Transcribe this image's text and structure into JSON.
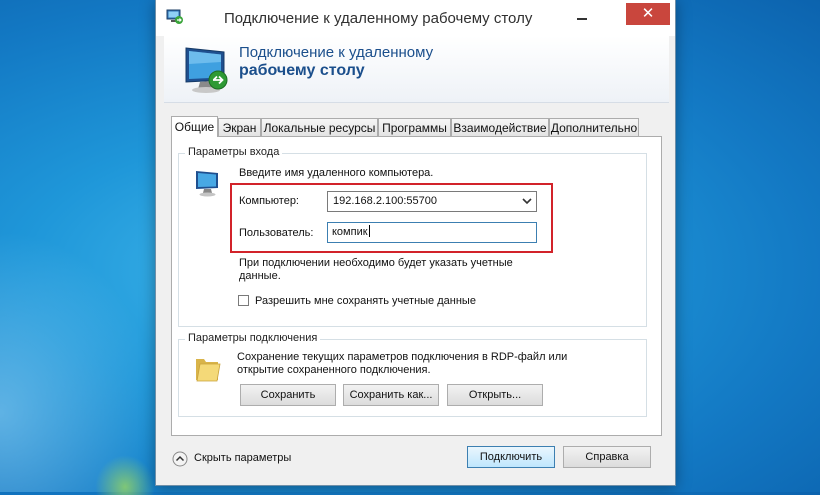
{
  "window": {
    "title": "Подключение к удаленному рабочему столу",
    "close_glyph": "✕",
    "minimize_icon": "minimize-icon",
    "app_icon": "remote-desktop-icon"
  },
  "banner": {
    "line1": "Подключение к удаленному",
    "line2": "рабочему столу",
    "icon": "remote-desktop-monitor-icon"
  },
  "tabs": [
    {
      "label": "Общие",
      "active": true
    },
    {
      "label": "Экран",
      "active": false
    },
    {
      "label": "Локальные ресурсы",
      "active": false
    },
    {
      "label": "Программы",
      "active": false
    },
    {
      "label": "Взаимодействие",
      "active": false
    },
    {
      "label": "Дополнительно",
      "active": false
    }
  ],
  "login": {
    "group_title": "Параметры входа",
    "instruction": "Введите имя удаленного компьютера.",
    "computer_label": "Компьютер:",
    "computer_value": "192.168.2.100:55700",
    "user_label": "Пользователь:",
    "user_value": "компик",
    "note": "При подключении необходимо будет указать учетные данные.",
    "save_credentials_label": "Разрешить мне сохранять учетные данные",
    "save_credentials_checked": false,
    "highlight_color": "#d2232a"
  },
  "connection": {
    "group_title": "Параметры подключения",
    "description_line1": "Сохранение текущих параметров подключения в RDP-файл или",
    "description_line2": "открытие сохраненного подключения.",
    "save_button": "Сохранить",
    "save_as_button": "Сохранить как...",
    "open_button": "Открыть..."
  },
  "footer": {
    "hide_params": "Скрыть параметры",
    "connect_button": "Подключить",
    "help_button": "Справка"
  },
  "colors": {
    "banner_text": "#1b4f8c",
    "close_button": "#c9463d",
    "desktop": "#1f97d9"
  }
}
